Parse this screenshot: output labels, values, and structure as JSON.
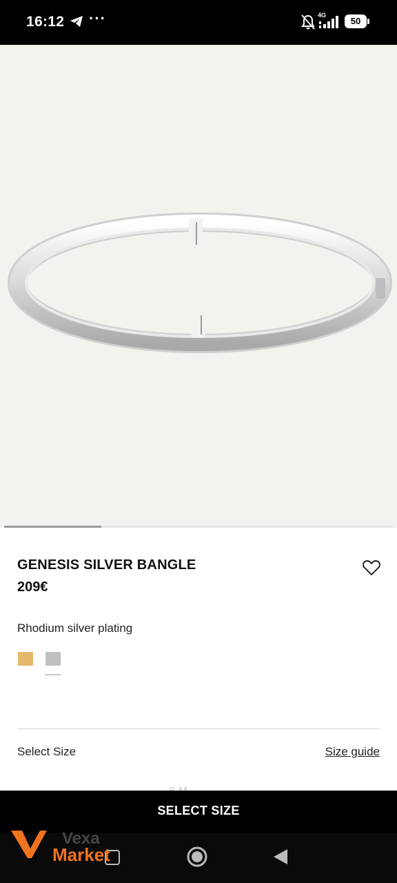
{
  "status_bar": {
    "time": "16:12",
    "more": "···",
    "network": "4G",
    "battery": "50"
  },
  "product": {
    "title": "GENESIS SILVER BANGLE",
    "price": "209€",
    "finish": "Rhodium silver plating",
    "swatches": [
      {
        "name": "gold",
        "color": "#e3b86a"
      },
      {
        "name": "silver",
        "color": "#c0c0c0",
        "selected": true
      }
    ],
    "image_alt": "silver bangle"
  },
  "size": {
    "label": "Select Size",
    "guide_link": "Size guide",
    "partial_text": "S          M"
  },
  "cta": {
    "label": "SELECT SIZE"
  },
  "carousel": {
    "current": 1,
    "total": 4
  },
  "watermark": {
    "line1": "Vexa",
    "line2": "Market",
    "color": "#f0731e"
  },
  "colors": {
    "background": "#ffffff",
    "image_bg": "#f3f2ee",
    "cta_bg": "#000000",
    "text": "#111111"
  }
}
